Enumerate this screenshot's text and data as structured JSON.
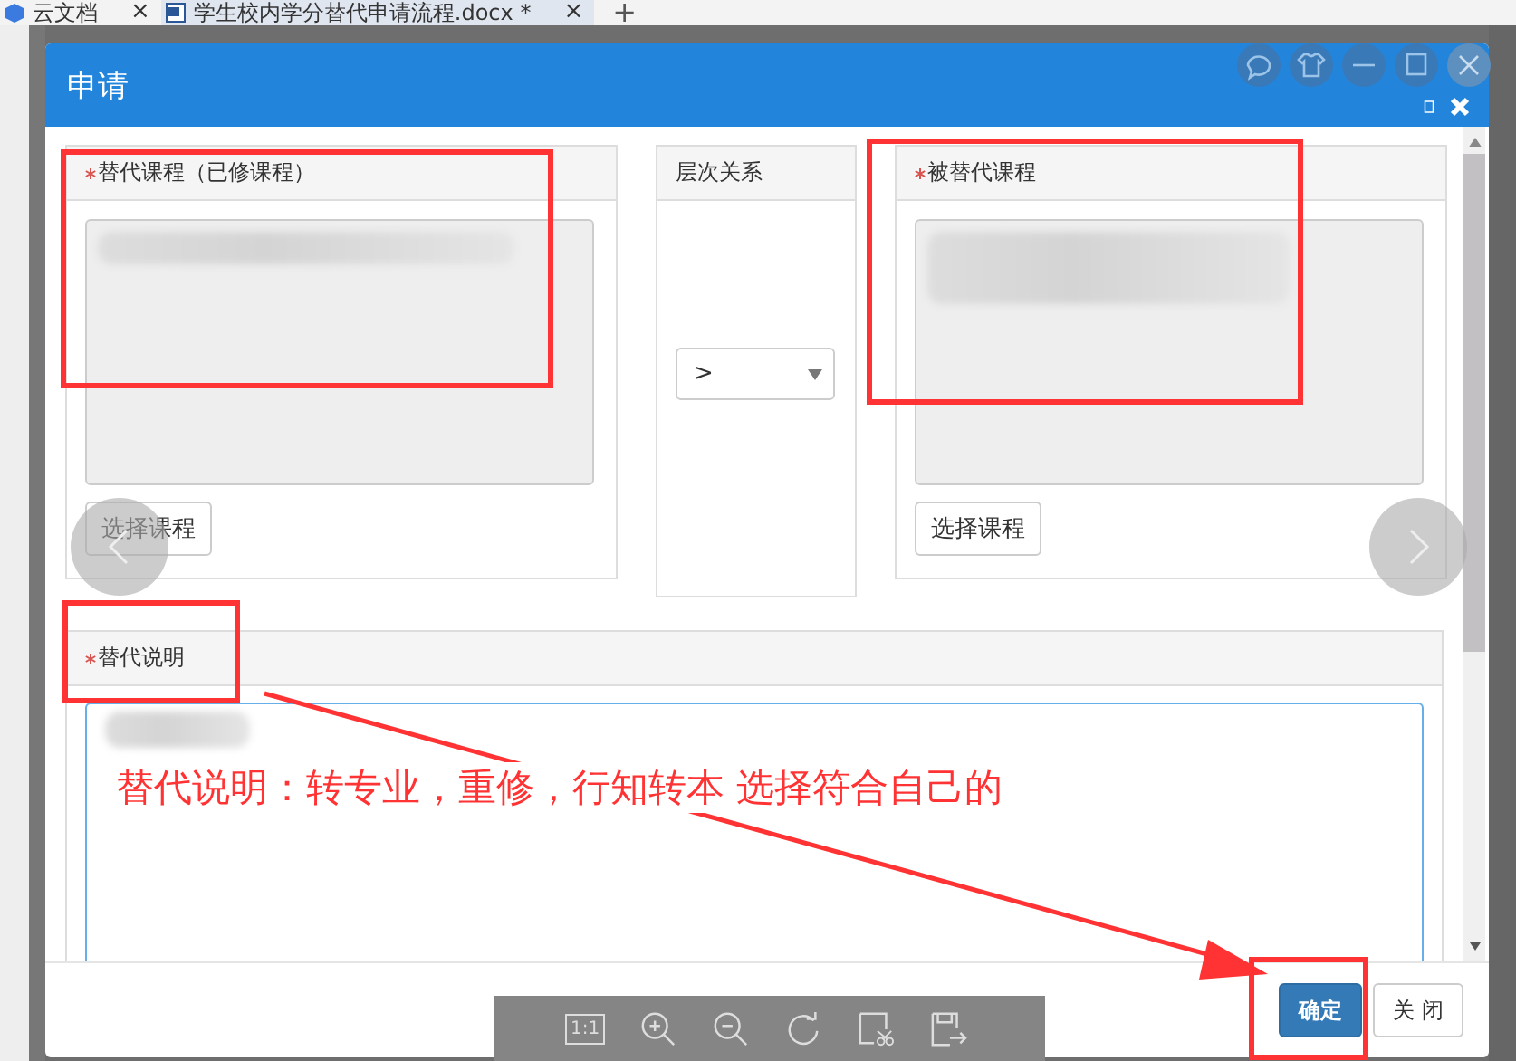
{
  "browser_tabs": [
    {
      "label": "云文档",
      "close": "×",
      "selected": false
    },
    {
      "label": "学生校内学分替代申请流程.docx *",
      "close": "×",
      "selected": true
    }
  ],
  "new_tab": "+",
  "dialog": {
    "title": "申请",
    "panels": [
      {
        "kind": "course",
        "label": "替代课程（已修课程）",
        "required": true,
        "button": "选择课程"
      },
      {
        "kind": "relation",
        "label": "层次关系",
        "required": false,
        "select_value": ">"
      },
      {
        "kind": "course",
        "label": "被替代课程",
        "required": true,
        "button": "选择课程"
      }
    ],
    "description": {
      "label": "替代说明",
      "required": true
    },
    "buttons": [
      {
        "label": "确定",
        "kind": "primary"
      },
      {
        "label": "关 闭",
        "kind": "default"
      }
    ]
  },
  "viewer_toolbar": {
    "zoom_label": "1:1"
  },
  "annotation": {
    "note": "替代说明：转专业，重修，行知转本 选择符合自己的"
  }
}
